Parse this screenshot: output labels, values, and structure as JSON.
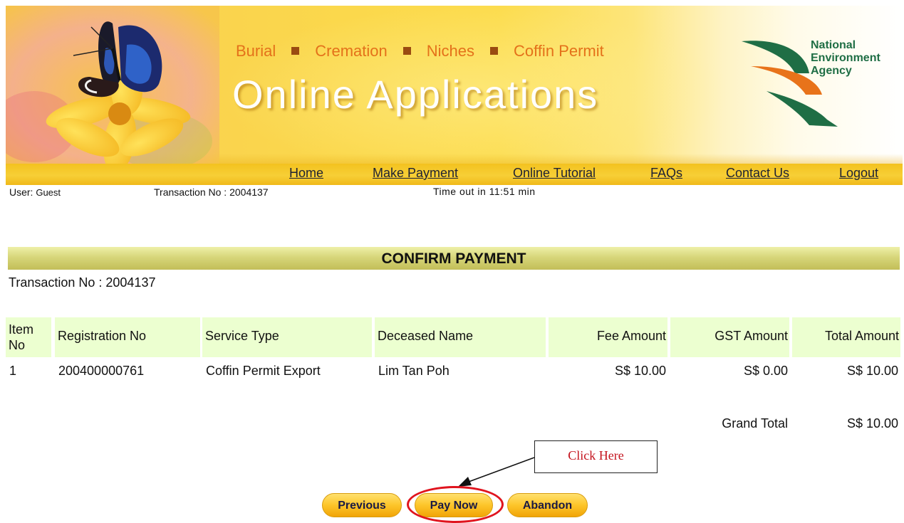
{
  "banner": {
    "categories": [
      "Burial",
      "Cremation",
      "Niches",
      "Coffin Permit"
    ],
    "title": "Online Applications",
    "agency": [
      "National",
      "Environment",
      "Agency"
    ],
    "colors": {
      "category_text": "#e4711a",
      "title_text": "#ffffff",
      "agency_text": "#1f6e45",
      "logo_orange": "#e8731a",
      "logo_green": "#1f6e45"
    }
  },
  "nav": {
    "items": [
      "Home",
      "Make Payment",
      "Online Tutorial",
      "FAQs",
      "Contact Us",
      "Logout"
    ]
  },
  "status": {
    "user_label": "User:",
    "user_value": "Guest",
    "transaction_label": "Transaction No :",
    "transaction_value": "2004137",
    "timeout": "Time out in 11:51 min"
  },
  "page": {
    "section_title": "CONFIRM PAYMENT",
    "transaction_line": "Transaction No : 2004137"
  },
  "table": {
    "headers": [
      "Item No",
      "Registration No",
      "Service Type",
      "Deceased Name",
      "Fee Amount",
      "GST Amount",
      "Total Amount"
    ],
    "rows": [
      [
        "1",
        "200400000761",
        "Coffin Permit Export",
        "Lim Tan Poh",
        "S$ 10.00",
        "S$ 0.00",
        "S$ 10.00"
      ]
    ],
    "grand_total_label": "Grand Total",
    "grand_total_value": "S$ 10.00"
  },
  "buttons": {
    "previous": "Previous",
    "pay_now": "Pay Now",
    "abandon": "Abandon"
  },
  "annotation": {
    "callout_text": "Click Here",
    "highlight_color": "#e0141e"
  }
}
